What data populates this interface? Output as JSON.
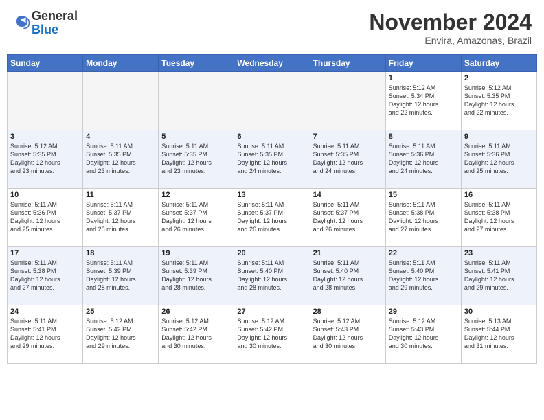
{
  "header": {
    "logo_general": "General",
    "logo_blue": "Blue",
    "month_title": "November 2024",
    "location": "Envira, Amazonas, Brazil"
  },
  "weekdays": [
    "Sunday",
    "Monday",
    "Tuesday",
    "Wednesday",
    "Thursday",
    "Friday",
    "Saturday"
  ],
  "weeks": [
    [
      {
        "day": "",
        "info": ""
      },
      {
        "day": "",
        "info": ""
      },
      {
        "day": "",
        "info": ""
      },
      {
        "day": "",
        "info": ""
      },
      {
        "day": "",
        "info": ""
      },
      {
        "day": "1",
        "info": "Sunrise: 5:12 AM\nSunset: 5:34 PM\nDaylight: 12 hours\nand 22 minutes."
      },
      {
        "day": "2",
        "info": "Sunrise: 5:12 AM\nSunset: 5:35 PM\nDaylight: 12 hours\nand 22 minutes."
      }
    ],
    [
      {
        "day": "3",
        "info": "Sunrise: 5:12 AM\nSunset: 5:35 PM\nDaylight: 12 hours\nand 23 minutes."
      },
      {
        "day": "4",
        "info": "Sunrise: 5:11 AM\nSunset: 5:35 PM\nDaylight: 12 hours\nand 23 minutes."
      },
      {
        "day": "5",
        "info": "Sunrise: 5:11 AM\nSunset: 5:35 PM\nDaylight: 12 hours\nand 23 minutes."
      },
      {
        "day": "6",
        "info": "Sunrise: 5:11 AM\nSunset: 5:35 PM\nDaylight: 12 hours\nand 24 minutes."
      },
      {
        "day": "7",
        "info": "Sunrise: 5:11 AM\nSunset: 5:35 PM\nDaylight: 12 hours\nand 24 minutes."
      },
      {
        "day": "8",
        "info": "Sunrise: 5:11 AM\nSunset: 5:36 PM\nDaylight: 12 hours\nand 24 minutes."
      },
      {
        "day": "9",
        "info": "Sunrise: 5:11 AM\nSunset: 5:36 PM\nDaylight: 12 hours\nand 25 minutes."
      }
    ],
    [
      {
        "day": "10",
        "info": "Sunrise: 5:11 AM\nSunset: 5:36 PM\nDaylight: 12 hours\nand 25 minutes."
      },
      {
        "day": "11",
        "info": "Sunrise: 5:11 AM\nSunset: 5:37 PM\nDaylight: 12 hours\nand 25 minutes."
      },
      {
        "day": "12",
        "info": "Sunrise: 5:11 AM\nSunset: 5:37 PM\nDaylight: 12 hours\nand 26 minutes."
      },
      {
        "day": "13",
        "info": "Sunrise: 5:11 AM\nSunset: 5:37 PM\nDaylight: 12 hours\nand 26 minutes."
      },
      {
        "day": "14",
        "info": "Sunrise: 5:11 AM\nSunset: 5:37 PM\nDaylight: 12 hours\nand 26 minutes."
      },
      {
        "day": "15",
        "info": "Sunrise: 5:11 AM\nSunset: 5:38 PM\nDaylight: 12 hours\nand 27 minutes."
      },
      {
        "day": "16",
        "info": "Sunrise: 5:11 AM\nSunset: 5:38 PM\nDaylight: 12 hours\nand 27 minutes."
      }
    ],
    [
      {
        "day": "17",
        "info": "Sunrise: 5:11 AM\nSunset: 5:38 PM\nDaylight: 12 hours\nand 27 minutes."
      },
      {
        "day": "18",
        "info": "Sunrise: 5:11 AM\nSunset: 5:39 PM\nDaylight: 12 hours\nand 28 minutes."
      },
      {
        "day": "19",
        "info": "Sunrise: 5:11 AM\nSunset: 5:39 PM\nDaylight: 12 hours\nand 28 minutes."
      },
      {
        "day": "20",
        "info": "Sunrise: 5:11 AM\nSunset: 5:40 PM\nDaylight: 12 hours\nand 28 minutes."
      },
      {
        "day": "21",
        "info": "Sunrise: 5:11 AM\nSunset: 5:40 PM\nDaylight: 12 hours\nand 28 minutes."
      },
      {
        "day": "22",
        "info": "Sunrise: 5:11 AM\nSunset: 5:40 PM\nDaylight: 12 hours\nand 29 minutes."
      },
      {
        "day": "23",
        "info": "Sunrise: 5:11 AM\nSunset: 5:41 PM\nDaylight: 12 hours\nand 29 minutes."
      }
    ],
    [
      {
        "day": "24",
        "info": "Sunrise: 5:11 AM\nSunset: 5:41 PM\nDaylight: 12 hours\nand 29 minutes."
      },
      {
        "day": "25",
        "info": "Sunrise: 5:12 AM\nSunset: 5:42 PM\nDaylight: 12 hours\nand 29 minutes."
      },
      {
        "day": "26",
        "info": "Sunrise: 5:12 AM\nSunset: 5:42 PM\nDaylight: 12 hours\nand 30 minutes."
      },
      {
        "day": "27",
        "info": "Sunrise: 5:12 AM\nSunset: 5:42 PM\nDaylight: 12 hours\nand 30 minutes."
      },
      {
        "day": "28",
        "info": "Sunrise: 5:12 AM\nSunset: 5:43 PM\nDaylight: 12 hours\nand 30 minutes."
      },
      {
        "day": "29",
        "info": "Sunrise: 5:12 AM\nSunset: 5:43 PM\nDaylight: 12 hours\nand 30 minutes."
      },
      {
        "day": "30",
        "info": "Sunrise: 5:13 AM\nSunset: 5:44 PM\nDaylight: 12 hours\nand 31 minutes."
      }
    ]
  ]
}
